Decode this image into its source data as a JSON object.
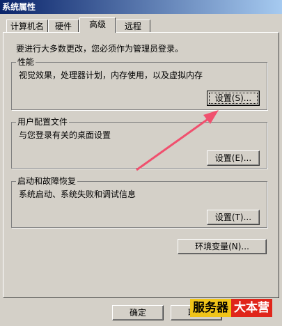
{
  "window": {
    "title": "系统属性"
  },
  "tabs": [
    {
      "label": "计算机名"
    },
    {
      "label": "硬件"
    },
    {
      "label": "高级"
    },
    {
      "label": "远程"
    }
  ],
  "admin_note": "要进行大多数更改，您必须作为管理员登录。",
  "performance": {
    "title": "性能",
    "desc": "视觉效果，处理器计划，内存使用，以及虚拟内存",
    "button": "设置(S)..."
  },
  "profile": {
    "title": "用户配置文件",
    "desc": "与您登录有关的桌面设置",
    "button": "设置(E)..."
  },
  "startup": {
    "title": "启动和故障恢复",
    "desc": "系统启动、系统失败和调试信息",
    "button": "设置(T)..."
  },
  "env_button": "环境变量(N)...",
  "footer": {
    "ok": "确定",
    "cancel": "取"
  },
  "watermark": {
    "part1": "服务器",
    "part2": "大本营"
  },
  "colors": {
    "arrow": "#f0506e",
    "title_bar": "#0a246a"
  }
}
